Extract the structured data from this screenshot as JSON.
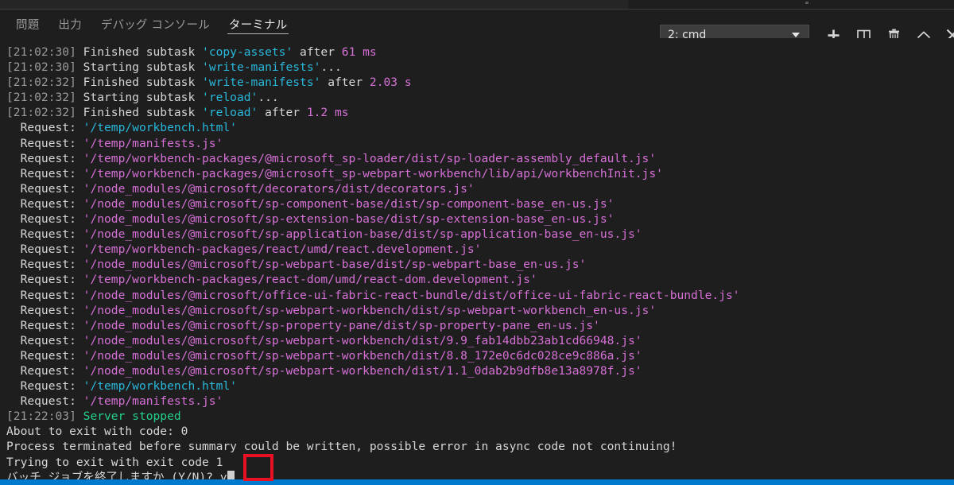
{
  "panel": {
    "tabs": [
      {
        "label": "問題",
        "name": "tab-problems",
        "active": false
      },
      {
        "label": "出力",
        "name": "tab-output",
        "active": false
      },
      {
        "label": "デバッグ コンソール",
        "name": "tab-debug-console",
        "active": false
      },
      {
        "label": "ターミナル",
        "name": "tab-terminal",
        "active": true
      }
    ],
    "terminal_selector": {
      "value": "2: cmd",
      "caret_icon": "chevron-down-icon"
    },
    "toolbar": [
      {
        "name": "new-terminal-button",
        "icon": "plus-icon"
      },
      {
        "name": "split-terminal-button",
        "icon": "split-panel-icon"
      },
      {
        "name": "kill-terminal-button",
        "icon": "trash-icon"
      },
      {
        "name": "maximize-panel-button",
        "icon": "chevron-up-icon"
      },
      {
        "name": "close-panel-button",
        "icon": "close-icon"
      }
    ]
  },
  "colors": {
    "background": "#1e1e1e",
    "header_background": "#252526",
    "foreground": "#cccccc",
    "timestamp": "#9a9a9a",
    "cyan": "#29b8db",
    "magenta": "#d670d6",
    "green": "#23d18b",
    "status_bar": "#007acc",
    "annotation": "#e81123",
    "select_background": "#3c3c3c"
  },
  "terminal": {
    "lines": [
      {
        "segments": [
          {
            "t": "[21:02:30] ",
            "c": "c-time"
          },
          {
            "t": "Finished subtask ",
            "c": "c-white"
          },
          {
            "t": "'copy-assets'",
            "c": "c-cyan"
          },
          {
            "t": " after ",
            "c": "c-white"
          },
          {
            "t": "61 ms",
            "c": "c-mag"
          }
        ]
      },
      {
        "segments": [
          {
            "t": "[21:02:30] ",
            "c": "c-time"
          },
          {
            "t": "Starting subtask ",
            "c": "c-white"
          },
          {
            "t": "'write-manifests'",
            "c": "c-cyan"
          },
          {
            "t": "...",
            "c": "c-white"
          }
        ]
      },
      {
        "segments": [
          {
            "t": "[21:02:32] ",
            "c": "c-time"
          },
          {
            "t": "Finished subtask ",
            "c": "c-white"
          },
          {
            "t": "'write-manifests'",
            "c": "c-cyan"
          },
          {
            "t": " after ",
            "c": "c-white"
          },
          {
            "t": "2.03 s",
            "c": "c-mag"
          }
        ]
      },
      {
        "segments": [
          {
            "t": "[21:02:32] ",
            "c": "c-time"
          },
          {
            "t": "Starting subtask ",
            "c": "c-white"
          },
          {
            "t": "'reload'",
            "c": "c-cyan"
          },
          {
            "t": "...",
            "c": "c-white"
          }
        ]
      },
      {
        "segments": [
          {
            "t": "[21:02:32] ",
            "c": "c-time"
          },
          {
            "t": "Finished subtask ",
            "c": "c-white"
          },
          {
            "t": "'reload'",
            "c": "c-cyan"
          },
          {
            "t": " after ",
            "c": "c-white"
          },
          {
            "t": "1.2 ms",
            "c": "c-mag"
          }
        ]
      },
      {
        "segments": [
          {
            "t": "  Request: ",
            "c": "c-white"
          },
          {
            "t": "'/temp/workbench.html'",
            "c": "c-cyan"
          }
        ]
      },
      {
        "segments": [
          {
            "t": "  Request: ",
            "c": "c-white"
          },
          {
            "t": "'/temp/manifests.js'",
            "c": "c-mag"
          }
        ]
      },
      {
        "segments": [
          {
            "t": "  Request: ",
            "c": "c-white"
          },
          {
            "t": "'/temp/workbench-packages/@microsoft_sp-loader/dist/sp-loader-assembly_default.js'",
            "c": "c-mag"
          }
        ]
      },
      {
        "segments": [
          {
            "t": "  Request: ",
            "c": "c-white"
          },
          {
            "t": "'/temp/workbench-packages/@microsoft_sp-webpart-workbench/lib/api/workbenchInit.js'",
            "c": "c-mag"
          }
        ]
      },
      {
        "segments": [
          {
            "t": "  Request: ",
            "c": "c-white"
          },
          {
            "t": "'/node_modules/@microsoft/decorators/dist/decorators.js'",
            "c": "c-mag"
          }
        ]
      },
      {
        "segments": [
          {
            "t": "  Request: ",
            "c": "c-white"
          },
          {
            "t": "'/node_modules/@microsoft/sp-component-base/dist/sp-component-base_en-us.js'",
            "c": "c-mag"
          }
        ]
      },
      {
        "segments": [
          {
            "t": "  Request: ",
            "c": "c-white"
          },
          {
            "t": "'/node_modules/@microsoft/sp-extension-base/dist/sp-extension-base_en-us.js'",
            "c": "c-mag"
          }
        ]
      },
      {
        "segments": [
          {
            "t": "  Request: ",
            "c": "c-white"
          },
          {
            "t": "'/node_modules/@microsoft/sp-application-base/dist/sp-application-base_en-us.js'",
            "c": "c-mag"
          }
        ]
      },
      {
        "segments": [
          {
            "t": "  Request: ",
            "c": "c-white"
          },
          {
            "t": "'/temp/workbench-packages/react/umd/react.development.js'",
            "c": "c-mag"
          }
        ]
      },
      {
        "segments": [
          {
            "t": "  Request: ",
            "c": "c-white"
          },
          {
            "t": "'/node_modules/@microsoft/sp-webpart-base/dist/sp-webpart-base_en-us.js'",
            "c": "c-mag"
          }
        ]
      },
      {
        "segments": [
          {
            "t": "  Request: ",
            "c": "c-white"
          },
          {
            "t": "'/temp/workbench-packages/react-dom/umd/react-dom.development.js'",
            "c": "c-mag"
          }
        ]
      },
      {
        "segments": [
          {
            "t": "  Request: ",
            "c": "c-white"
          },
          {
            "t": "'/node_modules/@microsoft/office-ui-fabric-react-bundle/dist/office-ui-fabric-react-bundle.js'",
            "c": "c-mag"
          }
        ]
      },
      {
        "segments": [
          {
            "t": "  Request: ",
            "c": "c-white"
          },
          {
            "t": "'/node_modules/@microsoft/sp-webpart-workbench/dist/sp-webpart-workbench_en-us.js'",
            "c": "c-mag"
          }
        ]
      },
      {
        "segments": [
          {
            "t": "  Request: ",
            "c": "c-white"
          },
          {
            "t": "'/node_modules/@microsoft/sp-property-pane/dist/sp-property-pane_en-us.js'",
            "c": "c-mag"
          }
        ]
      },
      {
        "segments": [
          {
            "t": "  Request: ",
            "c": "c-white"
          },
          {
            "t": "'/node_modules/@microsoft/sp-webpart-workbench/dist/9.9_fab14dbb23ab1cd66948.js'",
            "c": "c-mag"
          }
        ]
      },
      {
        "segments": [
          {
            "t": "  Request: ",
            "c": "c-white"
          },
          {
            "t": "'/node_modules/@microsoft/sp-webpart-workbench/dist/8.8_172e0c6dc028ce9c886a.js'",
            "c": "c-mag"
          }
        ]
      },
      {
        "segments": [
          {
            "t": "  Request: ",
            "c": "c-white"
          },
          {
            "t": "'/node_modules/@microsoft/sp-webpart-workbench/dist/1.1_0dab2b9dfb8e13a8978f.js'",
            "c": "c-mag"
          }
        ]
      },
      {
        "segments": [
          {
            "t": "  Request: ",
            "c": "c-white"
          },
          {
            "t": "'/temp/workbench.html'",
            "c": "c-cyan"
          }
        ]
      },
      {
        "segments": [
          {
            "t": "  Request: ",
            "c": "c-white"
          },
          {
            "t": "'/temp/manifests.js'",
            "c": "c-mag"
          }
        ]
      },
      {
        "segments": [
          {
            "t": "[21:22:03] ",
            "c": "c-time"
          },
          {
            "t": "Server stopped",
            "c": "c-green"
          }
        ]
      },
      {
        "segments": [
          {
            "t": "About to exit with code: 0",
            "c": "c-white"
          }
        ]
      },
      {
        "segments": [
          {
            "t": "Process terminated before summary could be written, possible error in async code not continuing!",
            "c": "c-white"
          }
        ]
      },
      {
        "segments": [
          {
            "t": "Trying to exit with exit code 1",
            "c": "c-white"
          }
        ]
      },
      {
        "segments": [
          {
            "t": "バッチ ジョブを終了しますか (Y/N)? y",
            "c": "c-white"
          }
        ],
        "cursor": true
      }
    ]
  },
  "annotation": {
    "name": "highlight-box",
    "target_text": "y"
  }
}
